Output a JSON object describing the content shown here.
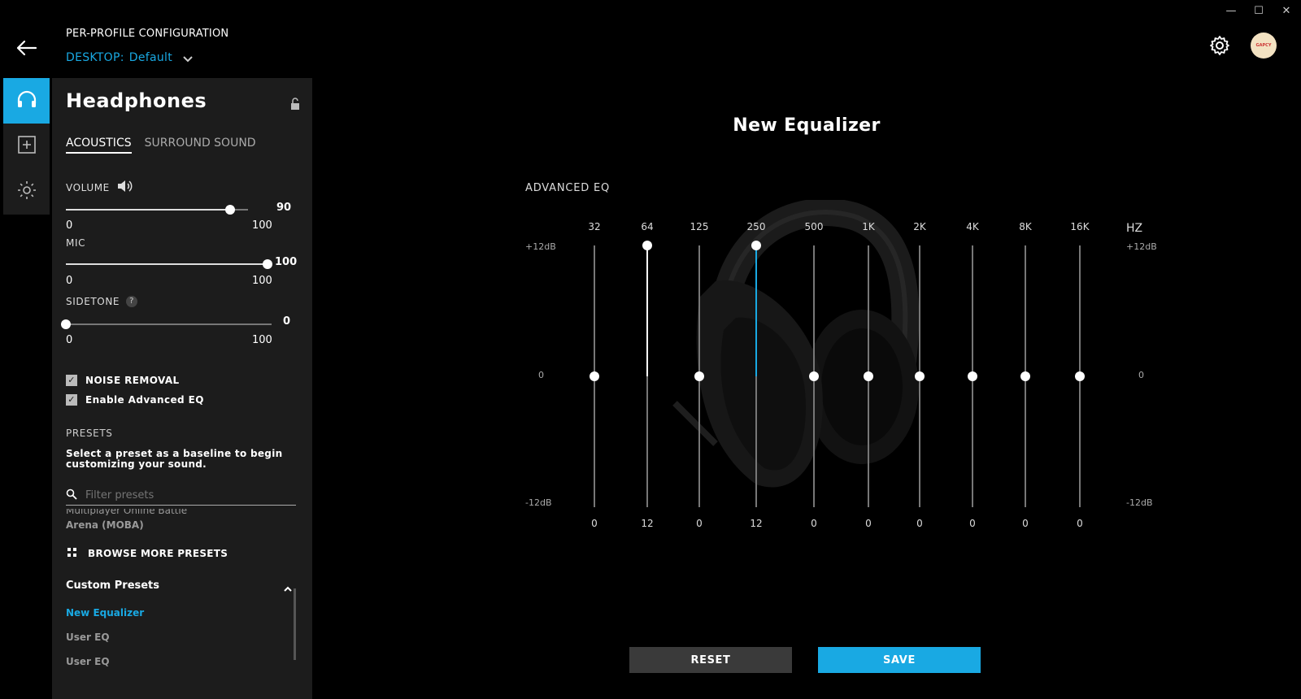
{
  "window": {
    "minimize": "—",
    "maximize": "☐",
    "close": "✕"
  },
  "header": {
    "title": "PER-PROFILE CONFIGURATION",
    "profile_prefix": "DESKTOP:",
    "profile_name": "Default",
    "avatar_text": "GAPCY"
  },
  "panel": {
    "title": "Headphones",
    "tabs": [
      {
        "label": "ACOUSTICS",
        "active": true
      },
      {
        "label": "SURROUND SOUND",
        "active": false
      }
    ],
    "sliders": {
      "volume": {
        "label": "VOLUME",
        "value": 90,
        "min": "0",
        "max": "100"
      },
      "mic": {
        "label": "MIC",
        "value": 100,
        "min": "0",
        "max": "100"
      },
      "sidetone": {
        "label": "SIDETONE",
        "value": 0,
        "min": "0",
        "max": "100",
        "help": "?"
      }
    },
    "checkboxes": [
      {
        "label": "NOISE REMOVAL",
        "checked": true
      },
      {
        "label": "Enable Advanced EQ",
        "checked": true
      }
    ],
    "presets_heading": "PRESETS",
    "presets_desc": "Select a preset as a baseline to begin customizing your sound.",
    "filter_placeholder": "Filter presets",
    "preset_clipped": "Multiplayer Online Battle",
    "preset_arena": "Arena (MOBA)",
    "browse_label": "BROWSE MORE PRESETS",
    "custom_heading": "Custom Presets",
    "custom_items": [
      {
        "label": "New Equalizer",
        "active": true
      },
      {
        "label": "User EQ",
        "active": false
      },
      {
        "label": "User EQ",
        "active": false
      }
    ]
  },
  "eq": {
    "title": "New Equalizer",
    "section": "ADVANCED EQ",
    "unit": "HZ",
    "db_top": "+12dB",
    "db_mid": "0",
    "db_bottom": "-12dB",
    "bands": [
      {
        "freq": "32",
        "value": 0
      },
      {
        "freq": "64",
        "value": 12
      },
      {
        "freq": "125",
        "value": 0
      },
      {
        "freq": "250",
        "value": 12,
        "selected": true
      },
      {
        "freq": "500",
        "value": 0
      },
      {
        "freq": "1K",
        "value": 0
      },
      {
        "freq": "2K",
        "value": 0
      },
      {
        "freq": "4K",
        "value": 0
      },
      {
        "freq": "8K",
        "value": 0
      },
      {
        "freq": "16K",
        "value": 0
      }
    ]
  },
  "buttons": {
    "reset": "RESET",
    "save": "SAVE"
  },
  "colors": {
    "accent": "#19a9e3",
    "panel": "#1c1c1c",
    "background": "#000000"
  }
}
